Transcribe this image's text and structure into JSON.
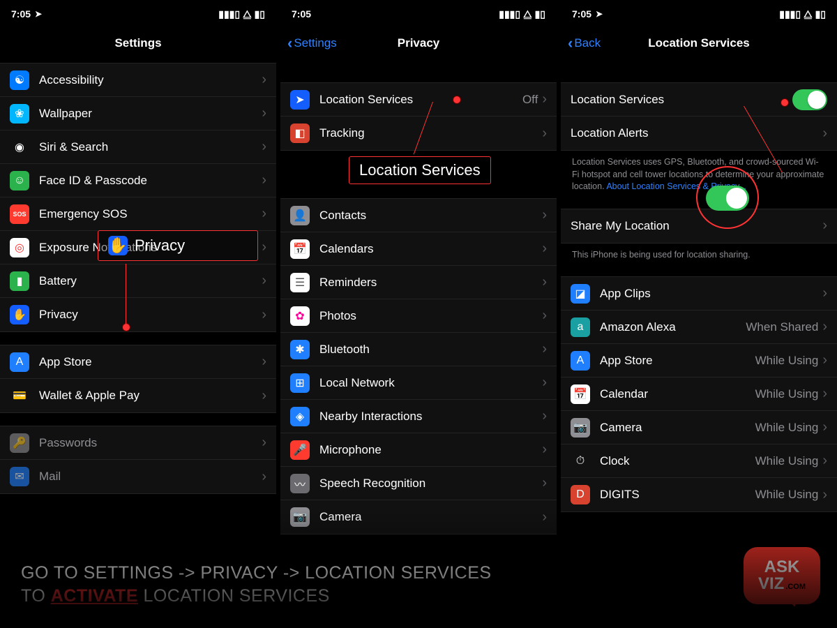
{
  "statusbar": {
    "time": "7:05",
    "loc_arrow": "➤"
  },
  "screen1": {
    "title": "Settings",
    "groups": [
      [
        {
          "label": "Accessibility",
          "iconbg": "#007aff",
          "glyph": "☯"
        },
        {
          "label": "Wallpaper",
          "iconbg": "#00b7ff",
          "glyph": "❀"
        },
        {
          "label": "Siri & Search",
          "iconbg": "#111",
          "glyph": "◉"
        },
        {
          "label": "Face ID & Passcode",
          "iconbg": "#2bb24c",
          "glyph": "☺"
        },
        {
          "label": "Emergency SOS",
          "iconbg": "#ff3b30",
          "glyph": "SOS",
          "small": true
        },
        {
          "label": "Exposure Notifications",
          "iconbg": "#fff",
          "glyph": "◎",
          "fg": "#f33"
        },
        {
          "label": "Battery",
          "iconbg": "#2bb24c",
          "glyph": "▮"
        },
        {
          "label": "Privacy",
          "iconbg": "#145dff",
          "glyph": "✋"
        }
      ],
      [
        {
          "label": "App Store",
          "iconbg": "#1f7fff",
          "glyph": "A"
        },
        {
          "label": "Wallet & Apple Pay",
          "iconbg": "#111",
          "glyph": "💳"
        }
      ],
      [
        {
          "label": "Passwords",
          "iconbg": "#8e8e93",
          "glyph": "🔑",
          "dim": true
        },
        {
          "label": "Mail",
          "iconbg": "#1f7fff",
          "glyph": "✉",
          "dim": true
        }
      ]
    ]
  },
  "callout1": {
    "label": "Privacy"
  },
  "screen2": {
    "back": "Settings",
    "title": "Privacy",
    "group_top": [
      {
        "label": "Location Services",
        "iconbg": "#145dff",
        "glyph": "➤",
        "value": "Off"
      },
      {
        "label": "Tracking",
        "iconbg": "#d8432f",
        "glyph": "◧"
      }
    ],
    "group_rest": [
      {
        "label": "Contacts",
        "iconbg": "#8e8e93",
        "glyph": "👤"
      },
      {
        "label": "Calendars",
        "iconbg": "#fff",
        "glyph": "📅",
        "fg": "#ff3b30"
      },
      {
        "label": "Reminders",
        "iconbg": "#fff",
        "glyph": "☰",
        "fg": "#555"
      },
      {
        "label": "Photos",
        "iconbg": "#fff",
        "glyph": "✿",
        "fg": "#f09"
      },
      {
        "label": "Bluetooth",
        "iconbg": "#1f7fff",
        "glyph": "✱"
      },
      {
        "label": "Local Network",
        "iconbg": "#1f7fff",
        "glyph": "⊞"
      },
      {
        "label": "Nearby Interactions",
        "iconbg": "#1f7fff",
        "glyph": "◈"
      },
      {
        "label": "Microphone",
        "iconbg": "#ff3b30",
        "glyph": "🎤"
      },
      {
        "label": "Speech Recognition",
        "iconbg": "#6b6b6f",
        "glyph": "〰"
      },
      {
        "label": "Camera",
        "iconbg": "#8e8e93",
        "glyph": "📷"
      }
    ]
  },
  "callout2": {
    "label": "Location Services"
  },
  "screen3": {
    "back": "Back",
    "title": "Location Services",
    "row_ls": "Location Services",
    "row_alerts": "Location Alerts",
    "note_text": "Location Services uses GPS, Bluetooth, and crowd-sourced Wi-Fi hotspot and cell tower locations to determine your approximate location. ",
    "note_link": "About Location Services & Privacy...",
    "row_share": "Share My Location",
    "share_note": "This iPhone is being used for location sharing.",
    "apps": [
      {
        "label": "App Clips",
        "iconbg": "#1f7fff",
        "glyph": "◪",
        "value": ""
      },
      {
        "label": "Amazon Alexa",
        "iconbg": "#1aa0a3",
        "glyph": "a",
        "value": "When Shared"
      },
      {
        "label": "App Store",
        "iconbg": "#1f7fff",
        "glyph": "A",
        "value": "While Using"
      },
      {
        "label": "Calendar",
        "iconbg": "#fff",
        "glyph": "📅",
        "fg": "#ff3b30",
        "value": "While Using"
      },
      {
        "label": "Camera",
        "iconbg": "#8e8e93",
        "glyph": "📷",
        "value": "While Using"
      },
      {
        "label": "Clock",
        "iconbg": "#111",
        "glyph": "⏱",
        "value": "While Using"
      },
      {
        "label": "DIGITS",
        "iconbg": "#d8432f",
        "glyph": "D",
        "value": "While Using"
      }
    ]
  },
  "caption": {
    "pre": "GO TO SETTINGS -> PRIVACY -> LOCATION SERVICES\nTO ",
    "hl": "ACTIVATE",
    "post": " LOCATION SERVICES"
  },
  "badge": {
    "l1": "ASK",
    "l2": "VIZ",
    "l3": ".COM"
  }
}
